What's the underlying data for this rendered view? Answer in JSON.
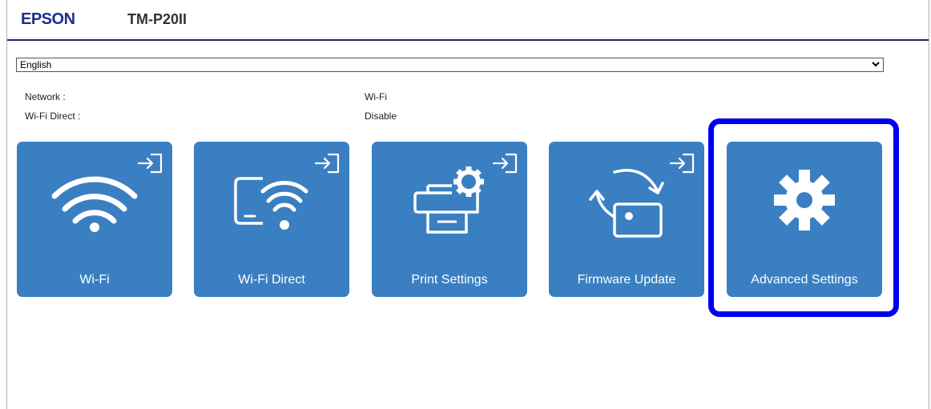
{
  "header": {
    "brand": "EPSON",
    "model": "TM-P20II"
  },
  "language": {
    "selected": "English"
  },
  "status": {
    "network_label": "Network :",
    "network_value": "Wi-Fi",
    "wifi_direct_label": "Wi-Fi Direct :",
    "wifi_direct_value": "Disable"
  },
  "tiles": [
    {
      "label": "Wi-Fi",
      "icon": "wifi-icon"
    },
    {
      "label": "Wi-Fi Direct",
      "icon": "phone-wifi-icon"
    },
    {
      "label": "Print Settings",
      "icon": "printer-gear-icon"
    },
    {
      "label": "Firmware Update",
      "icon": "firmware-update-icon"
    },
    {
      "label": "Advanced Settings",
      "icon": "gear-icon"
    }
  ],
  "colors": {
    "tile": "#3a7fc1",
    "brand": "#1a2d8f",
    "highlight": "#0000ee"
  }
}
